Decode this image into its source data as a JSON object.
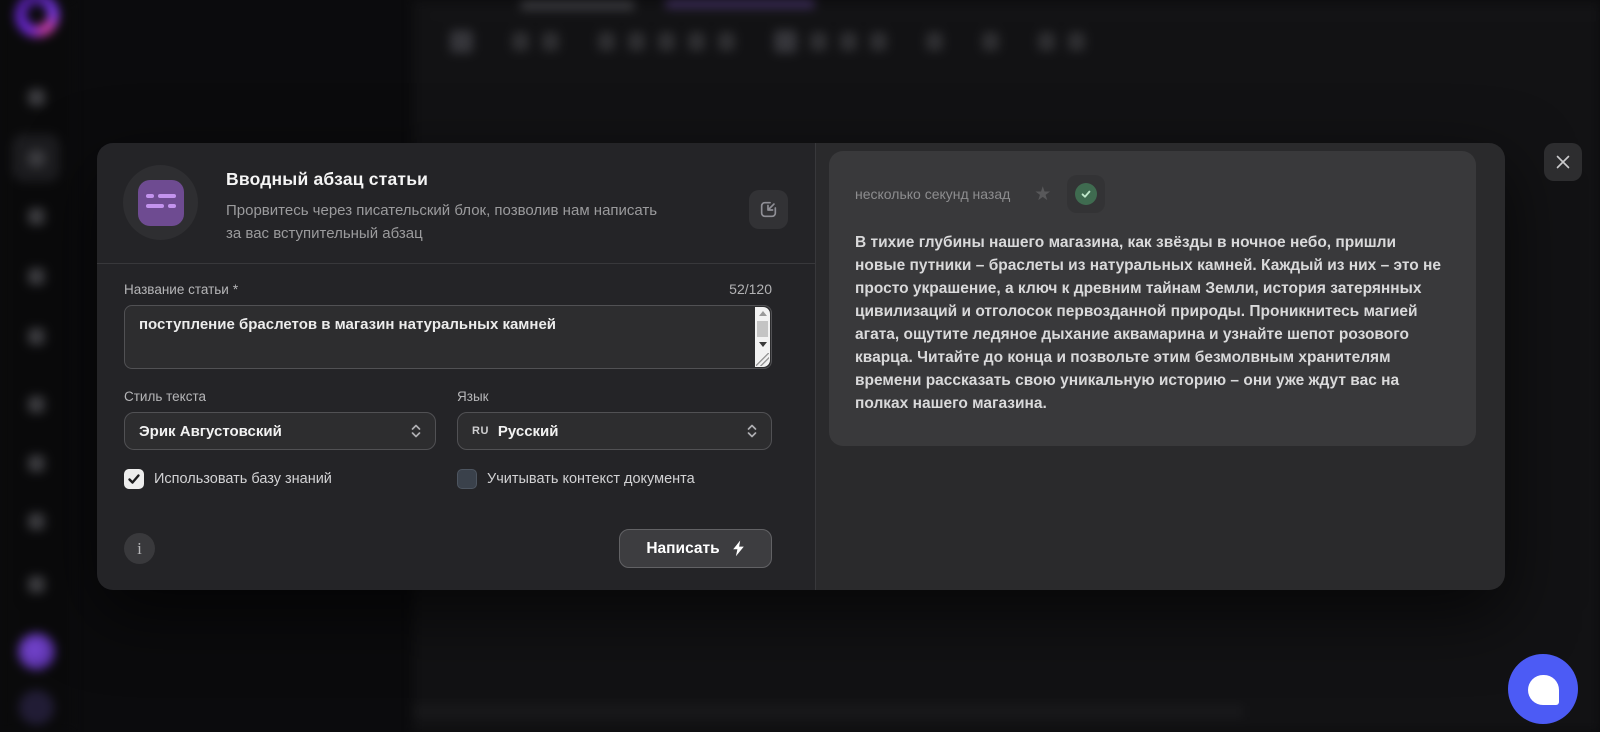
{
  "colors": {
    "accent_purple": "#6e4b91",
    "chat_blue": "#4c5bf5",
    "success_green": "#3f6b50"
  },
  "modal": {
    "header": {
      "title": "Вводный абзац статьи",
      "subtitle": "Прорвитесь через писательский блок, позволив нам написать за вас вступительный абзац",
      "icon": "document-lines-icon",
      "action_icon": "insert-into-document-icon"
    },
    "form": {
      "title_field": {
        "label": "Название статьи",
        "required_mark": "*",
        "counter": "52/120",
        "value": "поступление браслетов в магазин натуральных камней"
      },
      "style_select": {
        "label": "Стиль текста",
        "value": "Эрик Августовский"
      },
      "language_select": {
        "label": "Язык",
        "code": "RU",
        "value": "Русский"
      },
      "use_knowledge_base": {
        "label": "Использовать базу знаний",
        "checked": true
      },
      "use_document_context": {
        "label": "Учитывать контекст документа",
        "checked": false
      },
      "info_symbol": "i",
      "submit_label": "Написать"
    },
    "result": {
      "timestamp": "несколько секунд назад",
      "star_symbol": "★",
      "text": "В тихие глубины нашего магазина, как звёзды в ночное небо, пришли новые путники – браслеты из натуральных камней. Каждый из них – это не просто украшение, а ключ к древним тайнам Земли, история затерянных цивилизаций и отголосок первозданной природы. Проникнитесь магией агата, ощутите ледяное дыхание аквамарина и узнайте шепот розового кварца. Читайте до конца и позвольте этим безмолвным хранителям времени рассказать свою уникальную историю – они уже ждут вас на полках нашего магазина."
    }
  }
}
